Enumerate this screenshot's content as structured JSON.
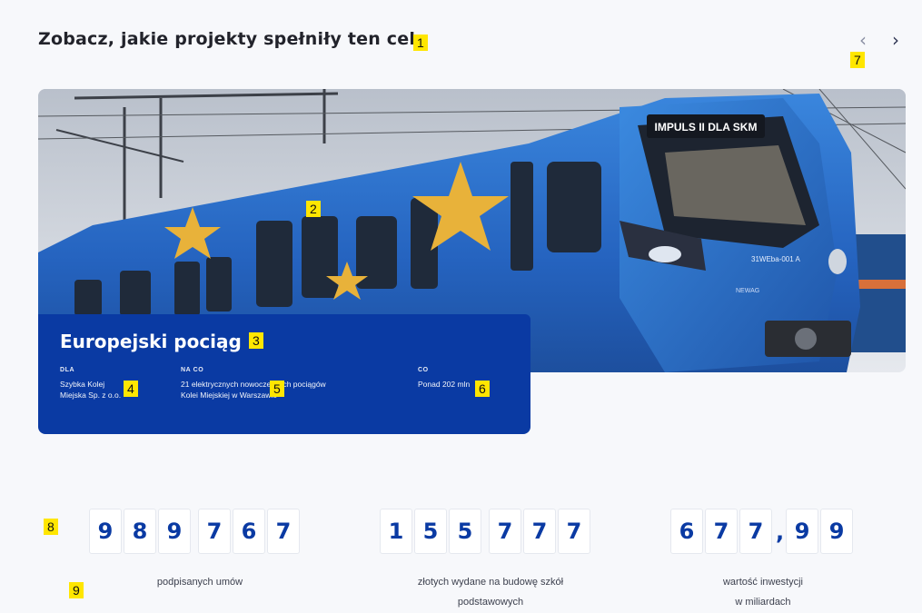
{
  "section_title": "Zobacz, jakie projekty spełniły ten cel",
  "nav": {
    "prev_icon": "‹",
    "next_icon": "›"
  },
  "markers": [
    "1",
    "2",
    "3",
    "4",
    "5",
    "6",
    "7",
    "8",
    "9"
  ],
  "hero": {
    "train_display": "IMPULS II DLA SKM",
    "train_number": "31WEba-001 A",
    "train_maker": "NEWAG"
  },
  "project": {
    "title": "Europejski pociąg",
    "for_label": "DLA",
    "for_value": "Szybka Kolej Miejska Sp. z o.o.",
    "what_label": "NA CO",
    "what_value": "21 elektrycznych nowoczesnych pociągów Kolei Miejskiej w Warszawie",
    "what_value_line1": "21 elektrycznych nowoczesnych pociągów",
    "what_value_line2": "Kolei Miejskiej w Warszawie",
    "what_amount_label": "CO",
    "amount_value": "Ponad 202 mln",
    "for_value_line1": "Szybka Kolej",
    "for_value_line2": "Miejska Sp. z o.o."
  },
  "counters": [
    {
      "digits": [
        "9",
        "8",
        "9",
        "7",
        "6",
        "7"
      ],
      "label_line1": "podpisanych umów",
      "label_line2": ""
    },
    {
      "digits": [
        "1",
        "5",
        "5",
        "7",
        "7",
        "7"
      ],
      "label_line1": "złotych wydane na budowę szkół",
      "label_line2": "podstawowych"
    },
    {
      "digits": [
        "6",
        "7",
        "7",
        ",",
        "9",
        "9"
      ],
      "label_line1": "wartość inwestycji",
      "label_line2": "w miliardach"
    }
  ],
  "colors": {
    "brand_blue": "#0a3aa3",
    "eu_star": "#e8b23a",
    "train_blue": "#2d76d2"
  }
}
